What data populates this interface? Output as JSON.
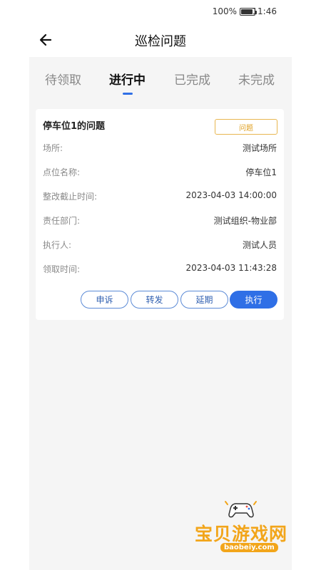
{
  "status_bar": {
    "battery": "100%",
    "time": "11:46"
  },
  "header": {
    "title": "巡检问题"
  },
  "tabs": [
    {
      "label": "待领取",
      "active": false
    },
    {
      "label": "进行中",
      "active": true
    },
    {
      "label": "已完成",
      "active": false
    },
    {
      "label": "未完成",
      "active": false
    }
  ],
  "card": {
    "title": "停车位1的问题",
    "tag": "问题",
    "rows": [
      {
        "label": "场所:",
        "value": "测试场所"
      },
      {
        "label": "点位名称:",
        "value": "停车位1"
      },
      {
        "label": "整改截止时间:",
        "value": "2023-04-03 14:00:00"
      },
      {
        "label": "责任部门:",
        "value": "测试组织-物业部"
      },
      {
        "label": "执行人:",
        "value": "测试人员"
      },
      {
        "label": "领取时间:",
        "value": "2023-04-03 11:43:28"
      }
    ],
    "actions": {
      "appeal": "申诉",
      "forward": "转发",
      "extend": "延期",
      "execute": "执行"
    }
  },
  "watermark": {
    "name": "宝贝游戏网",
    "url": "baobeiy.com"
  },
  "colors": {
    "accent": "#2f6fe6",
    "tag": "#e8b650",
    "panel_bg": "#f5f5f5"
  }
}
